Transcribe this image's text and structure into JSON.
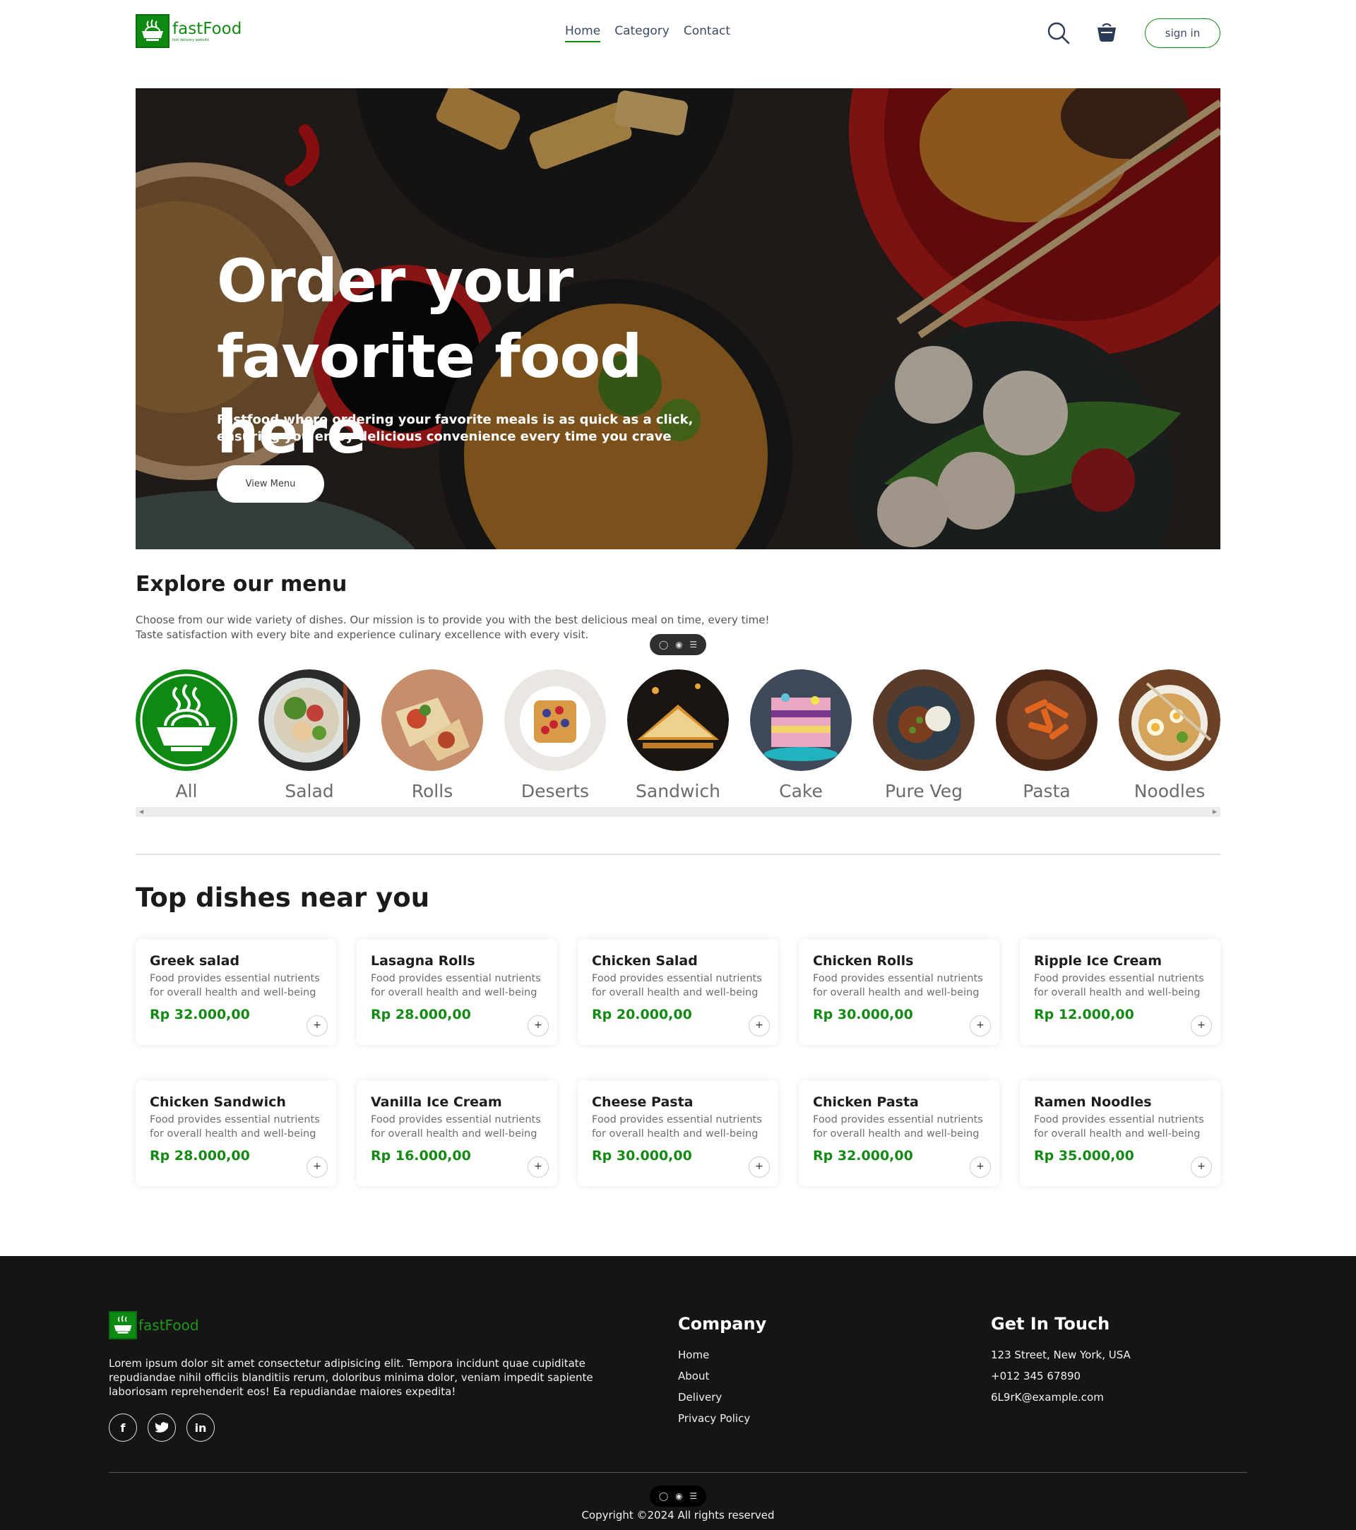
{
  "brand": {
    "name": "fastFood",
    "tagline": "fast delivery website",
    "accent": "#138a13"
  },
  "nav": {
    "items": [
      {
        "label": "Home",
        "active": true
      },
      {
        "label": "Category",
        "active": false
      },
      {
        "label": "Contact",
        "active": false
      }
    ]
  },
  "header": {
    "search_icon": "search-icon",
    "basket_icon": "basket-icon",
    "signin_label": "sign in"
  },
  "hero": {
    "title": "Order your favorite food here",
    "subtitle": "Fastfood where ordering your favorite meals is as quick as a click, ensuring you enjoy delicious convenience every time you crave",
    "button_label": "View Menu"
  },
  "explore": {
    "title": "Explore our menu",
    "description": "Choose from our wide variety of dishes. Our mission is to provide you with the best delicious meal on time, every time! Taste satisfaction with every bite and experience culinary excellence with every visit.",
    "categories": [
      {
        "label": "All",
        "icon": "noodle-bowl-icon"
      },
      {
        "label": "Salad"
      },
      {
        "label": "Rolls"
      },
      {
        "label": "Deserts"
      },
      {
        "label": "Sandwich"
      },
      {
        "label": "Cake"
      },
      {
        "label": "Pure Veg"
      },
      {
        "label": "Pasta"
      },
      {
        "label": "Noodles"
      }
    ]
  },
  "toolbar": {
    "icons": [
      "chat-icon",
      "eye-icon",
      "menu-icon"
    ]
  },
  "dishes": {
    "title": "Top dishes near you",
    "items": [
      {
        "name": "Greek salad",
        "desc": "Food provides essential nutrients for overall health and well-being",
        "price": "Rp 32.000,00"
      },
      {
        "name": "Lasagna Rolls",
        "desc": "Food provides essential nutrients for overall health and well-being",
        "price": "Rp 28.000,00"
      },
      {
        "name": "Chicken Salad",
        "desc": "Food provides essential nutrients for overall health and well-being",
        "price": "Rp 20.000,00"
      },
      {
        "name": "Chicken Rolls",
        "desc": "Food provides essential nutrients for overall health and well-being",
        "price": "Rp 30.000,00"
      },
      {
        "name": "Ripple Ice Cream",
        "desc": "Food provides essential nutrients for overall health and well-being",
        "price": "Rp 12.000,00"
      },
      {
        "name": "Chicken Sandwich",
        "desc": "Food provides essential nutrients for overall health and well-being",
        "price": "Rp 28.000,00"
      },
      {
        "name": "Vanilla Ice Cream",
        "desc": "Food provides essential nutrients for overall health and well-being",
        "price": "Rp 16.000,00"
      },
      {
        "name": "Cheese Pasta",
        "desc": "Food provides essential nutrients for overall health and well-being",
        "price": "Rp 30.000,00"
      },
      {
        "name": "Chicken Pasta",
        "desc": "Food provides essential nutrients for overall health and well-being",
        "price": "Rp 32.000,00"
      },
      {
        "name": "Ramen Noodles",
        "desc": "Food provides essential nutrients for overall health and well-being",
        "price": "Rp 35.000,00"
      }
    ],
    "add_label": "+"
  },
  "footer": {
    "brand": "fastFood",
    "about": "Lorem ipsum dolor sit amet consectetur adipisicing elit. Tempora incidunt quae cupiditate repudiandae nihil officiis blanditiis rerum, doloribus minima dolor, veniam impedit sapiente laboriosam reprehenderit eos! Ea repudiandae maiores expedita!",
    "socials": [
      {
        "icon": "facebook-icon",
        "glyph": "f"
      },
      {
        "icon": "twitter-icon",
        "glyph": "t"
      },
      {
        "icon": "linkedin-icon",
        "glyph": "in"
      }
    ],
    "company": {
      "title": "Company",
      "links": [
        "Home",
        "About",
        "Delivery",
        "Privacy Policy"
      ]
    },
    "contact": {
      "title": "Get In Touch",
      "lines": [
        "123 Street, New York, USA",
        "+012 345 67890",
        "6L9rK@example.com"
      ]
    },
    "copyright": "Copyright ©2024 All rights reserved"
  }
}
